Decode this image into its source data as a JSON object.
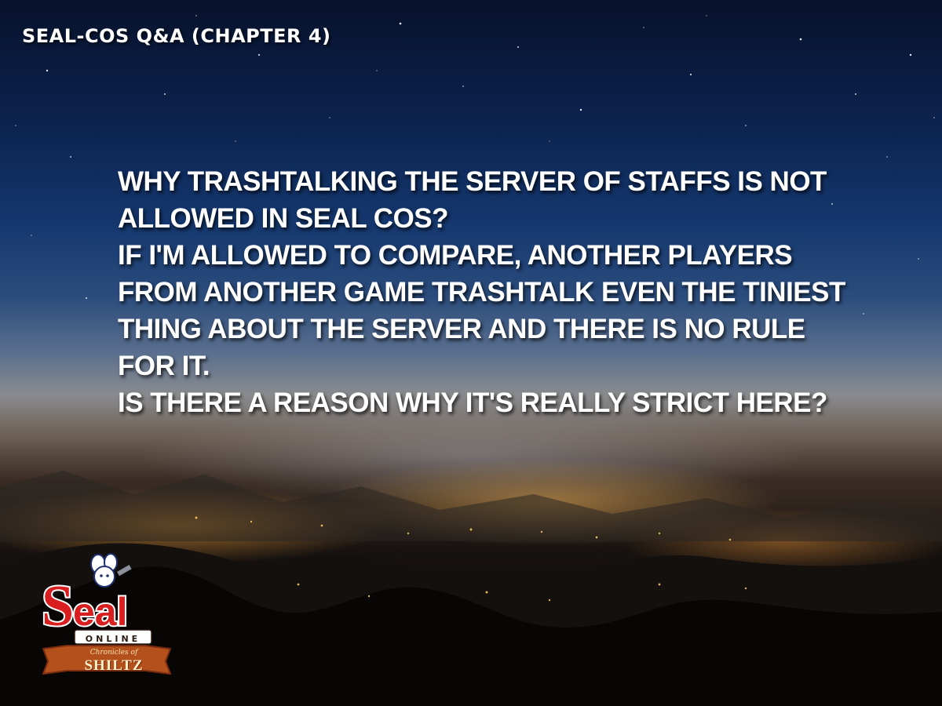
{
  "title": "SEAL-COS Q&A (CHAPTER 4)",
  "body": {
    "paragraphs": [
      "WHY TRASHTALKING THE SERVER OF STAFFS IS NOT ALLOWED IN SEAL COS?",
      "IF I'M ALLOWED TO COMPARE, ANOTHER PLAYERS FROM ANOTHER GAME TRASHTALK EVEN THE TINIEST THING ABOUT THE SERVER AND THERE IS NO RULE FOR IT.",
      "IS THERE A REASON WHY IT'S REALLY STRICT HERE?"
    ]
  },
  "logo": {
    "brand": "Seal",
    "subtitle": "ONLINE",
    "tagline": "Chronicles of",
    "name": "SHILTZ",
    "colors": {
      "red": "#d81e1e",
      "banner": "#b4501c",
      "ribbon_edge": "#7a2c10"
    }
  },
  "colors": {
    "text": "#ffffff",
    "sky_top": "#07122b",
    "sky_mid": "#15386f",
    "city_glow": "#ffb454"
  }
}
